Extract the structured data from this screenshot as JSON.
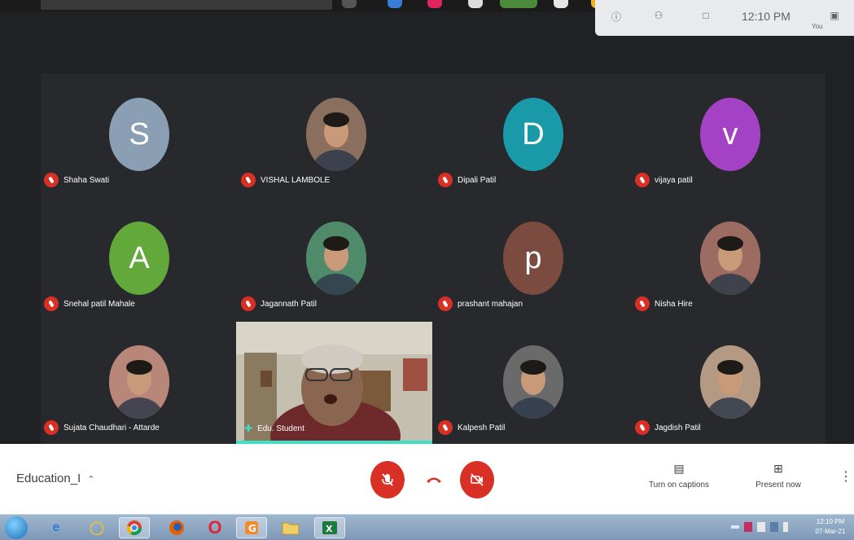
{
  "top_bar": {
    "clock": "12:10 PM",
    "you_label": "You"
  },
  "participants": [
    {
      "name": "Shaha Swati",
      "initial": "S",
      "color": "#8a9fb4",
      "kind": "letter"
    },
    {
      "name": "VISHAL LAMBOLE",
      "initial": "",
      "color": "#8b6f5e",
      "kind": "photo"
    },
    {
      "name": "Dipali Patil",
      "initial": "D",
      "color": "#1a9aa8",
      "kind": "letter"
    },
    {
      "name": "vijaya patil",
      "initial": "v",
      "color": "#a442c6",
      "kind": "letter"
    },
    {
      "name": "Snehal patil Mahale",
      "initial": "A",
      "color": "#63a83a",
      "kind": "letter"
    },
    {
      "name": "Jagannath Patil",
      "initial": "",
      "color": "#4f8a6b",
      "kind": "photo"
    },
    {
      "name": "prashant mahajan",
      "initial": "p",
      "color": "#7a4b3e",
      "kind": "letter"
    },
    {
      "name": "Nisha Hire",
      "initial": "",
      "color": "#9c6b61",
      "kind": "photo"
    },
    {
      "name": "Sujata Chaudhari - Attarde",
      "initial": "",
      "color": "#b8877a",
      "kind": "photo"
    },
    {
      "name": "Kalpesh Patil",
      "initial": "",
      "color": "#6a6a6a",
      "kind": "photo"
    },
    {
      "name": "Jagdish Patil",
      "initial": "",
      "color": "#b49a82",
      "kind": "photo"
    }
  ],
  "active_speaker": {
    "name": "Edu. Student"
  },
  "controls": {
    "meeting_title": "Education_I",
    "captions_label": "Turn on captions",
    "present_label": "Present now"
  },
  "taskbar": {
    "time": "12:10 PM",
    "date": "07-Mar-21"
  }
}
